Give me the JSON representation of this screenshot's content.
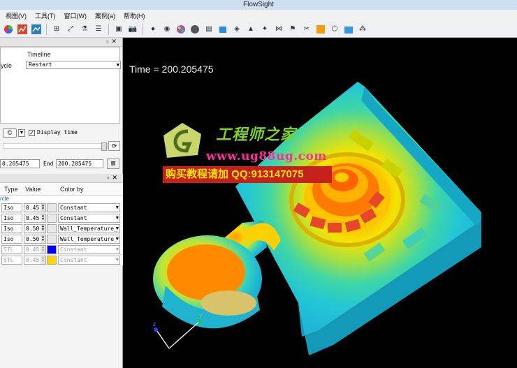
{
  "window": {
    "title": "FlowSight"
  },
  "menu": {
    "items": [
      "视图(V)",
      "工具(T)",
      "窗口(W)",
      "案例(a)",
      "帮助(H)"
    ]
  },
  "animation_panel": {
    "header": "Timeline",
    "cycle_label": "ycle",
    "mode_value": "Restart",
    "display_time_label": "Display time",
    "display_time_checked": true,
    "start_value": "0.205475",
    "end_label": "End",
    "end_value": "200.205475"
  },
  "plot_panel": {
    "columns": {
      "type": "Type",
      "value": "Value",
      "color_by": "Color by"
    },
    "group_label": "rcle",
    "rows": [
      {
        "type": "Iso",
        "value": "0.45",
        "swatch": "#e8e8e8",
        "color_by": "Constant",
        "dim": false
      },
      {
        "type": "Iso",
        "value": "0.45",
        "swatch": "#e8e8e8",
        "color_by": "Constant",
        "dim": false
      },
      {
        "type": "Iso",
        "value": "0.50",
        "swatch": "#e8e8e8",
        "color_by": "Wall_Temperature_",
        "dim": false
      },
      {
        "type": "Iso",
        "value": "0.50",
        "swatch": "#e8e8e8",
        "color_by": "Wall_Temperature_",
        "dim": false
      },
      {
        "type": "STL",
        "value": "0.45",
        "swatch": "#0000ff",
        "color_by": "Constant",
        "dim": true
      },
      {
        "type": "STL",
        "value": "0.45",
        "swatch": "#ffd600",
        "color_by": "Constant",
        "dim": true
      }
    ]
  },
  "viewport": {
    "time_text": "Time = 200.205475",
    "axis_labels": {
      "y": "Y",
      "z": "Z"
    }
  },
  "watermark": {
    "line1": "工程师之家",
    "line2": "www.ug88ug.com",
    "line3": "购买教程请加 QQ:913147075"
  }
}
